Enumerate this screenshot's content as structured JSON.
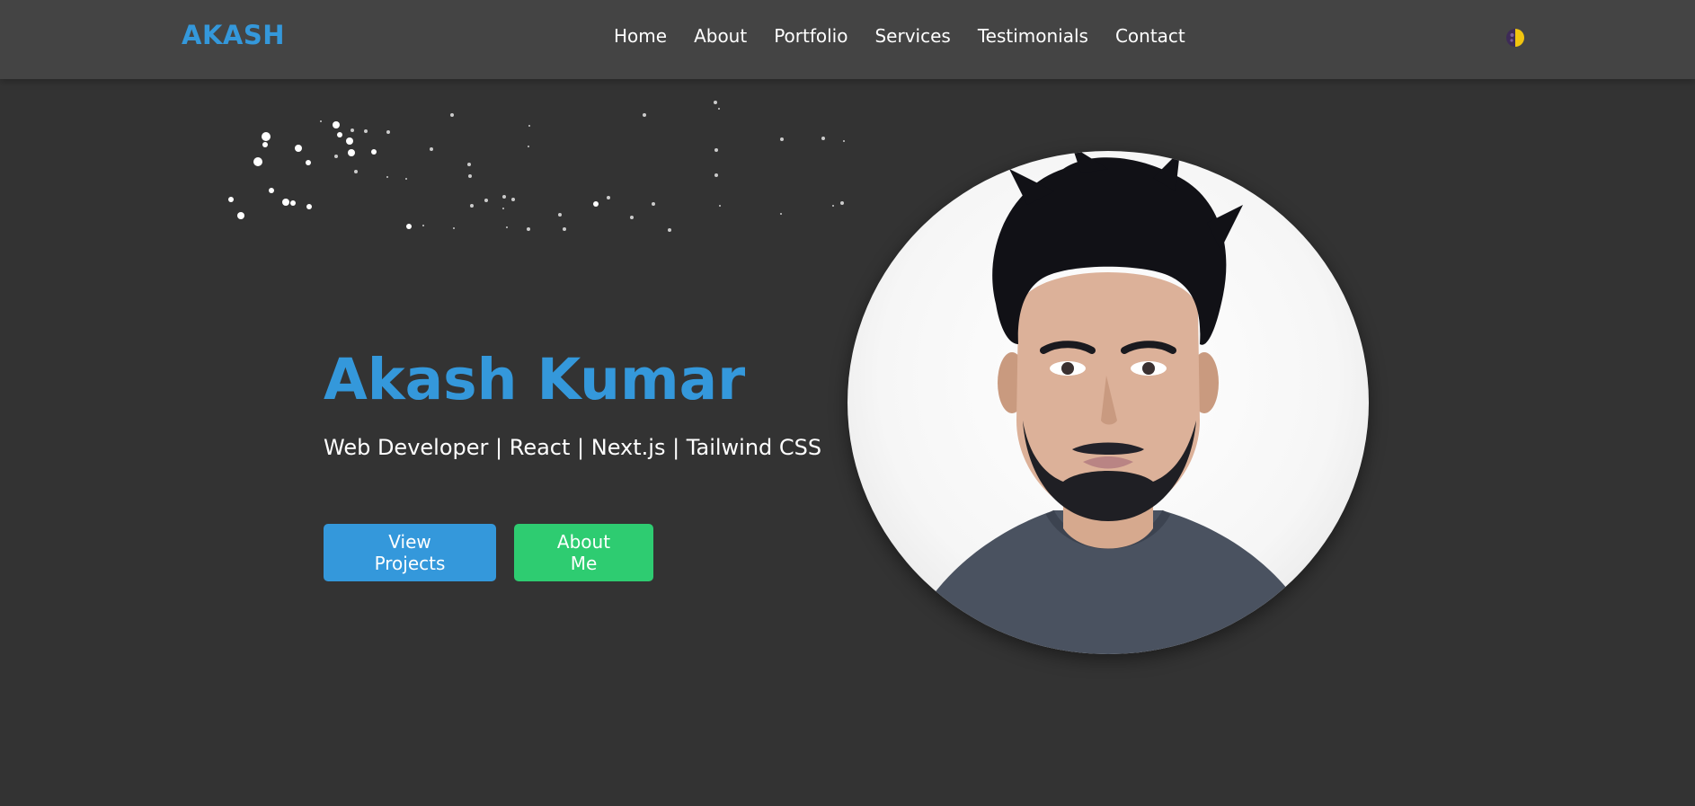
{
  "brand": {
    "logo_text": "AKASH",
    "accent_color": "#3498db",
    "secondary_color": "#2ecc71"
  },
  "nav": {
    "links": [
      {
        "label": "Home"
      },
      {
        "label": "About"
      },
      {
        "label": "Portfolio"
      },
      {
        "label": "Services"
      },
      {
        "label": "Testimonials"
      },
      {
        "label": "Contact"
      }
    ],
    "theme_toggle_icon": "half-moon-icon"
  },
  "hero": {
    "name": "Akash Kumar",
    "tagline": "Web Developer | React | Next.js | Tailwind CSS",
    "buttons": {
      "primary_label": "View Projects",
      "secondary_label": "About Me"
    },
    "portrait_icon": "profile-photo"
  },
  "background": {
    "decoration": "star-particles"
  }
}
